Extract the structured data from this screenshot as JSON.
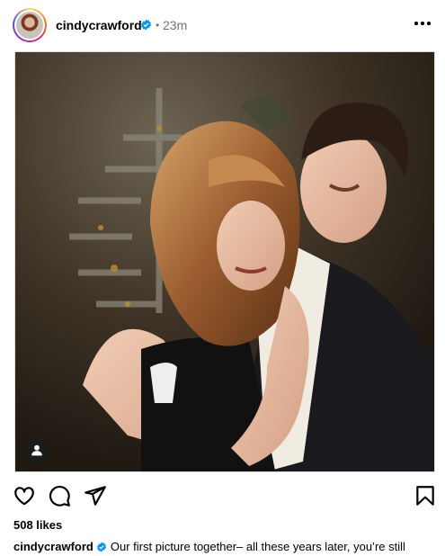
{
  "post": {
    "username": "cindycrawford",
    "separator": "•",
    "timestamp": "23m",
    "likes": "508 likes",
    "caption_user": "cindycrawford",
    "caption_text": "Our first picture together– all these years later, you’re still"
  },
  "icons": {
    "avatar": "profile-avatar",
    "verified": "verified-badge-icon",
    "more": "more-options-icon",
    "user_tag": "user-tag-icon",
    "like": "heart-icon",
    "comment": "comment-icon",
    "share": "send-icon",
    "save": "bookmark-icon"
  },
  "colors": {
    "verified": "#0095f6",
    "secondary_text": "#737373",
    "photo_border": "#dbdbdb"
  }
}
